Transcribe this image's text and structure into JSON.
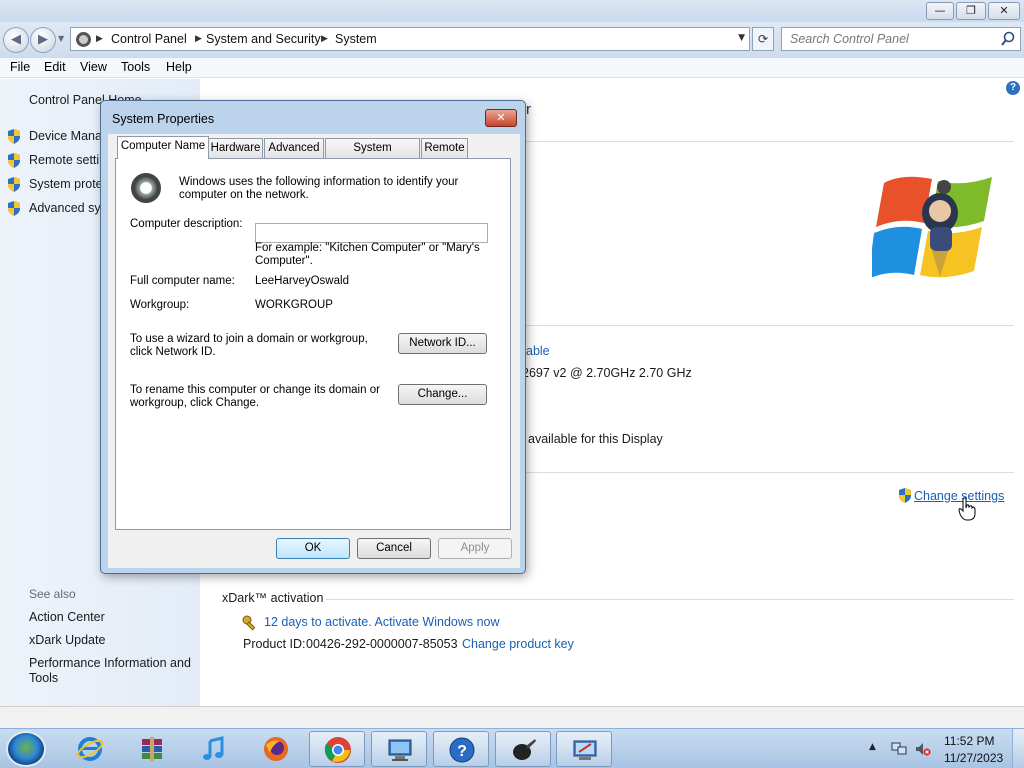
{
  "window": {
    "buttons": {
      "minimize": "—",
      "maximize": "❐",
      "close": "✕"
    }
  },
  "address": {
    "crumbs": [
      "Control Panel",
      "System and Security",
      "System"
    ],
    "search_placeholder": "Search Control Panel"
  },
  "menu": [
    "File",
    "Edit",
    "View",
    "Tools",
    "Help"
  ],
  "sidebar": {
    "home": "Control Panel Home",
    "tasks": [
      "Device Manag",
      "Remote settin",
      "System prote",
      "Advanced sys"
    ],
    "see_also_heading": "See also",
    "see_also": [
      "Action Center",
      "xDark Update",
      "Performance Information and Tools"
    ]
  },
  "content": {
    "title_fragment": "r",
    "fragments": {
      "pen_touch_link_tail": "able",
      "processor_tail": "2697 v2 @ 2.70GHz   2.70 GHz",
      "pen_tail": "available for this Display"
    },
    "change_settings": "Change settings",
    "activation": {
      "heading": "xDark™ activation",
      "days_text": "12 days to activate. Activate Windows now",
      "product_id_label": "Product ID:",
      "product_id": "00426-292-0000007-85053",
      "change_key": "Change product key"
    }
  },
  "dialog": {
    "title": "System Properties",
    "close_glyph": "✕",
    "tabs": [
      "Computer Name",
      "Hardware",
      "Advanced",
      "System Protection",
      "Remote"
    ],
    "intro": "Windows uses the following information to identify your computer on the network.",
    "description_label": "Computer description:",
    "description_value": "",
    "example": "For example: \"Kitchen Computer\" or \"Mary's Computer\".",
    "full_name_label": "Full computer name:",
    "full_name": "LeeHarveyOswald",
    "workgroup_label": "Workgroup:",
    "workgroup": "WORKGROUP",
    "network_id_text": "To use a wizard to join a domain or workgroup, click Network ID.",
    "network_id_button": "Network ID...",
    "rename_text": "To rename this computer or change its domain or workgroup, click Change.",
    "change_button": "Change...",
    "ok": "OK",
    "cancel": "Cancel",
    "apply": "Apply"
  },
  "taskbar": {
    "apps": [
      "internet-explorer-icon",
      "winrar-icon",
      "itunes-icon",
      "firefox-icon",
      "chrome-icon",
      "computer-icon",
      "help-icon",
      "paint-icon",
      "system-icon"
    ],
    "time": "11:52 PM",
    "date": "11/27/2023"
  },
  "colors": {
    "link": "#1a5fb4",
    "dialog_frame": "#bcd3ec",
    "taskbar": "#a8c4e3"
  }
}
